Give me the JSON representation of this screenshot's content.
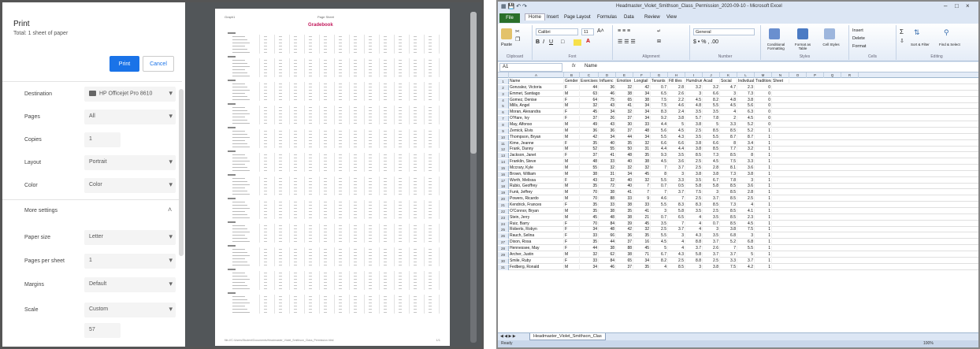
{
  "print_dialog": {
    "title": "Print",
    "subtitle": "Total: 1 sheet of paper",
    "print_button": "Print",
    "cancel_button": "Cancel",
    "settings": [
      {
        "label": "Destination",
        "value": "HP Officejet Pro 8610",
        "type": "select",
        "icon": "printer-icon"
      },
      {
        "label": "Pages",
        "value": "All",
        "type": "select"
      },
      {
        "label": "Copies",
        "value": "1",
        "type": "input"
      },
      {
        "label": "Layout",
        "value": "Portrait",
        "type": "select"
      },
      {
        "label": "Color",
        "value": "Color",
        "type": "select"
      },
      {
        "label": "More settings",
        "value": "",
        "type": "expander"
      },
      {
        "label": "Paper size",
        "value": "Letter",
        "type": "select"
      },
      {
        "label": "Pages per sheet",
        "value": "1",
        "type": "select"
      },
      {
        "label": "Margins",
        "value": "Default",
        "type": "select"
      },
      {
        "label": "Scale",
        "value": "Custom",
        "type": "select"
      },
      {
        "label": "",
        "value": "57",
        "type": "input"
      }
    ]
  },
  "preview": {
    "header_left": "Graph1",
    "header_mid": "Page Sheet",
    "title": "Gradebook",
    "footer": "file:///C:/Users/Student/Documents/Headmaster_Violet_Smithson_Class_Permission.html",
    "page_number": "1/1"
  },
  "excel": {
    "window_title": "Headmaster_Violet_Smithson_Class_Permission_2020-09-10 - Microsoft Excel",
    "file_tab": "File",
    "tabs": [
      "Home",
      "Insert",
      "Page Layout",
      "Formulas",
      "Data",
      "Review",
      "View"
    ],
    "ribbon": {
      "font_name": "Calibri",
      "font_size": "11",
      "number_format": "General",
      "groups": [
        "Clipboard",
        "Font",
        "Alignment",
        "Number",
        "Styles",
        "Cells",
        "Editing"
      ],
      "buttons": {
        "paste": "Paste",
        "conditional": "Conditional Formatting",
        "format_table": "Format as Table",
        "cell_styles": "Cell Styles",
        "insert": "Insert",
        "delete": "Delete",
        "format": "Format",
        "sort": "Sort & Filter",
        "find": "Find & Select"
      }
    },
    "name_box": "A1",
    "fx_label": "fx",
    "formula_content": "Name",
    "columns": [
      "A",
      "B",
      "C",
      "D",
      "E",
      "F",
      "G",
      "H",
      "I",
      "J",
      "K",
      "L",
      "M",
      "N",
      "O",
      "P",
      "Q",
      "R"
    ],
    "header_row": [
      "Name",
      "Gender",
      "Exercises",
      "Influenc",
      "Emotion",
      "Longtail",
      "Tenants",
      "Fill tiles",
      "Humdrum",
      "Acad",
      "Social",
      "Indivdual",
      "Traditional",
      "Sheet"
    ],
    "rows": [
      [
        "Gonzalez, Victoria",
        "F",
        "44",
        "36",
        "32",
        "42",
        "0.7",
        "2.8",
        "3.2",
        "3.2",
        "4.7",
        "2.3",
        "0"
      ],
      [
        "Emmet, Santiago",
        "M",
        "63",
        "46",
        "38",
        "34",
        "6.5",
        "2.6",
        "3",
        "6.6",
        "3",
        "7.3",
        "0"
      ],
      [
        "Gomez, Denise",
        "F",
        "64",
        "75",
        "65",
        "38",
        "7.5",
        "2.2",
        "4.5",
        "8.2",
        "4.8",
        "3.8",
        "0"
      ],
      [
        "Mills, Angel",
        "M",
        "32",
        "43",
        "41",
        "34",
        "7.5",
        "4.6",
        "4.8",
        "5.5",
        "4.5",
        "5.6",
        "0"
      ],
      [
        "Moran, Alexandra",
        "F",
        "45",
        "34",
        "32",
        "34",
        "8.3",
        "2.4",
        "3.5",
        "3.5",
        "4",
        "6.3",
        "0"
      ],
      [
        "O'Hare, Ivy",
        "F",
        "37",
        "26",
        "37",
        "34",
        "9.2",
        "3.8",
        "5.7",
        "7.8",
        "2",
        "4.5",
        "0"
      ],
      [
        "May, Alfonso",
        "M",
        "49",
        "43",
        "30",
        "33",
        "4.4",
        "5",
        "3.8",
        "5",
        "3.3",
        "5.2",
        "0"
      ],
      [
        "Zemick, Elvis",
        "M",
        "36",
        "36",
        "37",
        "48",
        "5.6",
        "4.5",
        "2.5",
        "8.5",
        "8.5",
        "5.2",
        "1"
      ],
      [
        "Thompson, Bryan",
        "M",
        "42",
        "34",
        "44",
        "34",
        "5.5",
        "4.3",
        "3.5",
        "5.5",
        "8.7",
        "8.7",
        "1"
      ],
      [
        "Kime, Jeanne",
        "F",
        "35",
        "40",
        "35",
        "32",
        "6.6",
        "6.6",
        "3.8",
        "6.6",
        "8",
        "3.4",
        "1"
      ],
      [
        "Frank, Danny",
        "M",
        "52",
        "55",
        "50",
        "31",
        "4.4",
        "4.4",
        "3.8",
        "8.5",
        "7.7",
        "3.2",
        "1"
      ],
      [
        "Jackson, Janet",
        "F",
        "37",
        "41",
        "48",
        "35",
        "9.3",
        "3.5",
        "8.5",
        "7.3",
        "8.5",
        "8",
        "1"
      ],
      [
        "Franklin, Steve",
        "M",
        "48",
        "33",
        "40",
        "38",
        "4.5",
        "3.6",
        "2.5",
        "4.5",
        "7.5",
        "3.3",
        "1"
      ],
      [
        "Mccrary, Kyle",
        "M",
        "55",
        "32",
        "32",
        "32",
        "7",
        "3.7",
        "2.5",
        "2.8",
        "8.1",
        "3.6",
        "1"
      ],
      [
        "Brown, William",
        "M",
        "38",
        "31",
        "34",
        "45",
        "8",
        "3",
        "3.8",
        "3.8",
        "7.3",
        "3.8",
        "1"
      ],
      [
        "Worth, Melissa",
        "F",
        "43",
        "32",
        "40",
        "32",
        "5.5",
        "3.3",
        "3.5",
        "6.7",
        "7.8",
        "3",
        "1"
      ],
      [
        "Rubio, Geoffrey",
        "M",
        "35",
        "72",
        "40",
        "7",
        "0.7",
        "0.5",
        "5.8",
        "5.8",
        "8.5",
        "3.6",
        "1"
      ],
      [
        "Funk, Jeffrey",
        "M",
        "70",
        "38",
        "41",
        "7",
        "7",
        "3.7",
        "7.5",
        "3",
        "8.5",
        "2.8",
        "1"
      ],
      [
        "Powers, Ricardo",
        "M",
        "70",
        "88",
        "33",
        "9",
        "4.6",
        "7",
        "2.5",
        "3.7",
        "8.5",
        "2.5",
        "1"
      ],
      [
        "Kendrick, Frances",
        "F",
        "35",
        "33",
        "38",
        "33",
        "5.5",
        "8.3",
        "8.3",
        "8.5",
        "7.3",
        "4",
        "1"
      ],
      [
        "O'Connor, Bryan",
        "M",
        "35",
        "38",
        "35",
        "41",
        "3",
        "5.8",
        "3.5",
        "2.5",
        "8.5",
        "4.1",
        "1"
      ],
      [
        "Stein, Jerry",
        "M",
        "45",
        "48",
        "38",
        "21",
        "0.7",
        "6.5",
        "4",
        "3.5",
        "8.5",
        "2.3",
        "1"
      ],
      [
        "Ruiz, Barry",
        "F",
        "70",
        "84",
        "39",
        "45",
        "3.5",
        "7",
        "4",
        "0.7",
        "8.5",
        "4.5",
        "1"
      ],
      [
        "Roberts, Robyn",
        "F",
        "34",
        "48",
        "42",
        "32",
        "2.5",
        "3.7",
        "4",
        "3",
        "3.8",
        "7.5",
        "1"
      ],
      [
        "Rauch, Selina",
        "F",
        "33",
        "66",
        "36",
        "35",
        "5.5",
        "3",
        "4.3",
        "3.5",
        "6.8",
        "3",
        "1"
      ],
      [
        "Dixon, Rosa",
        "F",
        "35",
        "44",
        "37",
        "16",
        "4.5",
        "4",
        "8.8",
        "3.7",
        "5.2",
        "6.8",
        "1"
      ],
      [
        "Hennessee, May",
        "F",
        "44",
        "38",
        "88",
        "45",
        "5",
        "4",
        "3.7",
        "2.6",
        "7",
        "5.5",
        "1"
      ],
      [
        "Archer, Justin",
        "M",
        "32",
        "62",
        "38",
        "71",
        "6.7",
        "4.3",
        "5.8",
        "3.7",
        "3.7",
        "5",
        "1"
      ],
      [
        "Smile, Ruby",
        "F",
        "33",
        "84",
        "65",
        "34",
        "8.2",
        "2.5",
        "8.8",
        "2.5",
        "3.3",
        "3.7",
        "1"
      ],
      [
        "Fedberg, Ronald",
        "M",
        "34",
        "46",
        "37",
        "35",
        "4",
        "8.5",
        "3",
        "3.8",
        "7.5",
        "4.2",
        "1"
      ]
    ],
    "sheet_tab": "Headmaster_Violet_Smithson_Clas",
    "status_ready": "Ready",
    "zoom": "100%"
  }
}
